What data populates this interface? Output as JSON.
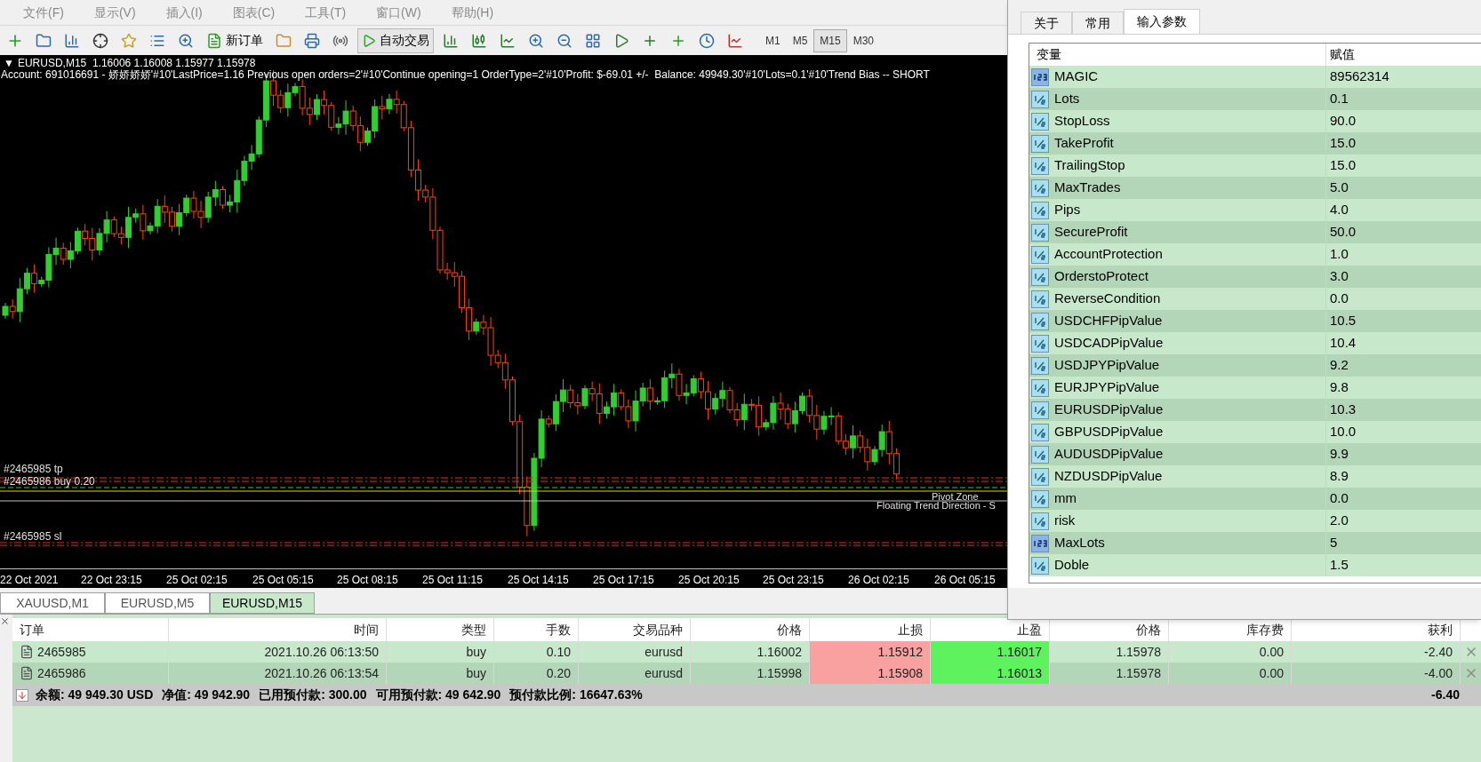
{
  "menu": [
    "文件(F)",
    "显示(V)",
    "插入(I)",
    "图表(C)",
    "工具(T)",
    "窗口(W)",
    "帮助(H)"
  ],
  "toolbar": {
    "new_order": "新订单",
    "auto_trading": "自动交易",
    "periods": [
      {
        "label": "M1",
        "selected": false
      },
      {
        "label": "M5",
        "selected": false
      },
      {
        "label": "M15",
        "selected": true
      },
      {
        "label": "M30",
        "selected": false
      }
    ]
  },
  "chart": {
    "collapse_glyph": "▼",
    "header": "EURUSD,M15  1.16006 1.16008 1.15977 1.15978",
    "comment": "Account: 691016691 - 娇娇娇娇'#10'LastPrice=1.16 Previous open orders=2'#10'Continue opening=1 OrderType=2'#10'Profit: $-69.01 +/-  Balance: 49949.30'#10'Lots=0.1'#10'Trend Bias -- SHORT",
    "order_labels": [
      "#2465985 tp",
      "#2465986 buy 0.20",
      "#2465985 sl"
    ],
    "pivot_label": "Pivot Zone",
    "trend_label": "Floating Trend Direction - S",
    "time_labels": [
      "22 Oct 2021",
      "22 Oct 23:15",
      "25 Oct 02:15",
      "25 Oct 05:15",
      "25 Oct 08:15",
      "25 Oct 11:15",
      "25 Oct 14:15",
      "25 Oct 17:15",
      "25 Oct 20:15",
      "25 Oct 23:15",
      "26 Oct 02:15",
      "26 Oct 05:15"
    ]
  },
  "chart_tabs": [
    {
      "label": "XAUUSD,M1",
      "selected": false
    },
    {
      "label": "EURUSD,M5",
      "selected": false
    },
    {
      "label": "EURUSD,M15",
      "selected": true
    }
  ],
  "terminal": {
    "columns": [
      "订单",
      "时间",
      "类型",
      "手数",
      "交易品种",
      "价格",
      "止损",
      "止盈",
      "价格",
      "库存费",
      "获利"
    ],
    "rows": [
      {
        "cells": [
          "2465985",
          "2021.10.26 06:13:50",
          "buy",
          "0.10",
          "eurusd",
          "1.16002",
          "1.15912",
          "1.16017",
          "1.15978",
          "0.00",
          "-2.40"
        ]
      },
      {
        "cells": [
          "2465986",
          "2021.10.26 06:13:54",
          "buy",
          "0.20",
          "eurusd",
          "1.15998",
          "1.15908",
          "1.16013",
          "1.15978",
          "0.00",
          "-4.00"
        ]
      }
    ],
    "summary": [
      "余额: 49 949.30 USD",
      "净值: 49 942.90",
      "已用预付款: 300.00",
      "可用预付款: 49 642.90",
      "预付款比例: 16647.63%"
    ],
    "total": "-6.40"
  },
  "dialog": {
    "tabs": [
      {
        "label": "关于",
        "selected": false
      },
      {
        "label": "常用",
        "selected": false
      },
      {
        "label": "输入参数",
        "selected": true
      }
    ],
    "columns": [
      "变量",
      "赋值"
    ],
    "params": [
      {
        "kind": "int",
        "name": "MAGIC",
        "value": "89562314"
      },
      {
        "kind": "double",
        "name": "Lots",
        "value": "0.1"
      },
      {
        "kind": "double",
        "name": "StopLoss",
        "value": "90.0"
      },
      {
        "kind": "double",
        "name": "TakeProfit",
        "value": "15.0"
      },
      {
        "kind": "double",
        "name": "TrailingStop",
        "value": "15.0"
      },
      {
        "kind": "double",
        "name": "MaxTrades",
        "value": "5.0"
      },
      {
        "kind": "double",
        "name": "Pips",
        "value": "4.0"
      },
      {
        "kind": "double",
        "name": "SecureProfit",
        "value": "50.0"
      },
      {
        "kind": "double",
        "name": "AccountProtection",
        "value": "1.0"
      },
      {
        "kind": "double",
        "name": "OrderstoProtect",
        "value": "3.0"
      },
      {
        "kind": "double",
        "name": "ReverseCondition",
        "value": "0.0"
      },
      {
        "kind": "double",
        "name": "USDCHFPipValue",
        "value": "10.5"
      },
      {
        "kind": "double",
        "name": "USDCADPipValue",
        "value": "10.4"
      },
      {
        "kind": "double",
        "name": "USDJPYPipValue",
        "value": "9.2"
      },
      {
        "kind": "double",
        "name": "EURJPYPipValue",
        "value": "9.8"
      },
      {
        "kind": "double",
        "name": "EURUSDPipValue",
        "value": "10.3"
      },
      {
        "kind": "double",
        "name": "GBPUSDPipValue",
        "value": "10.0"
      },
      {
        "kind": "double",
        "name": "AUDUSDPipValue",
        "value": "9.9"
      },
      {
        "kind": "double",
        "name": "NZDUSDPipValue",
        "value": "8.9"
      },
      {
        "kind": "double",
        "name": "mm",
        "value": "0.0"
      },
      {
        "kind": "double",
        "name": "risk",
        "value": "2.0"
      },
      {
        "kind": "int",
        "name": "MaxLots",
        "value": "5"
      },
      {
        "kind": "double",
        "name": "Doble",
        "value": "1.5"
      }
    ]
  }
}
